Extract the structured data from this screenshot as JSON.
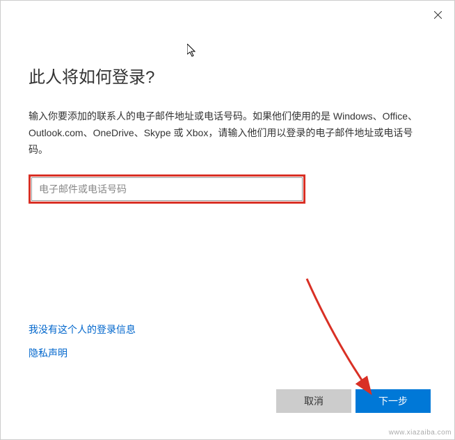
{
  "dialog": {
    "title": "此人将如何登录?",
    "description": "输入你要添加的联系人的电子邮件地址或电话号码。如果他们使用的是 Windows、Office、Outlook.com、OneDrive、Skype 或 Xbox，请输入他们用以登录的电子邮件地址或电话号码。",
    "input": {
      "placeholder": "电子邮件或电话号码",
      "value": ""
    },
    "links": {
      "no_info": "我没有这个人的登录信息",
      "privacy": "隐私声明"
    },
    "buttons": {
      "cancel": "取消",
      "next": "下一步"
    }
  },
  "watermark": "www.xiazaiba.com"
}
